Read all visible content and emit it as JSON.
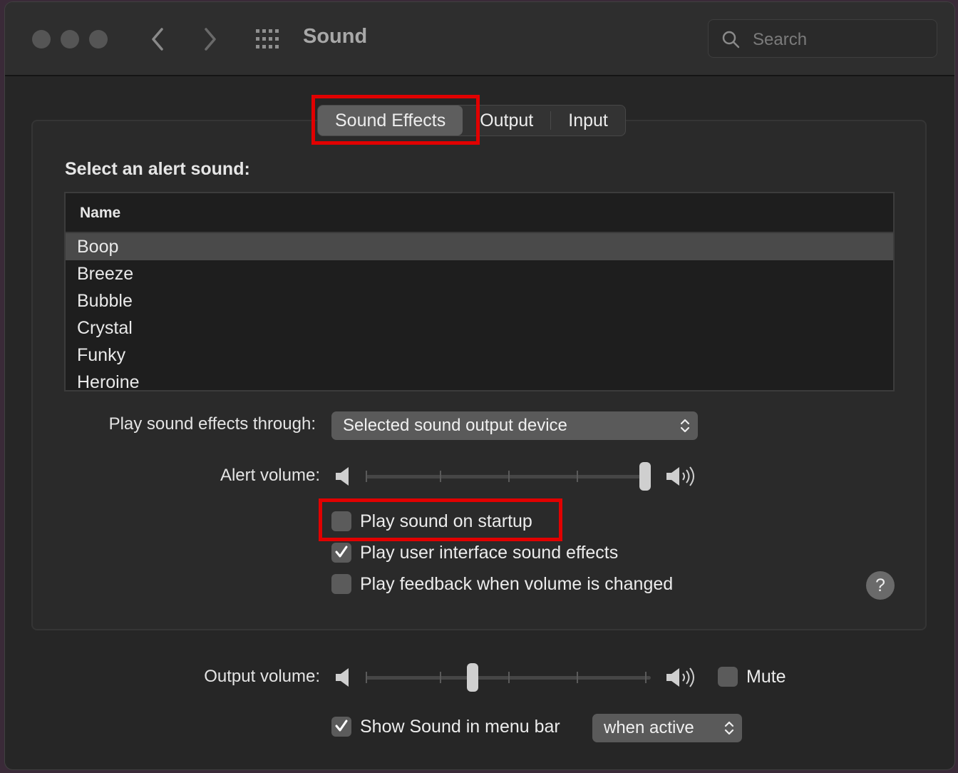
{
  "window": {
    "title": "Sound"
  },
  "search": {
    "placeholder": "Search"
  },
  "tabs": [
    {
      "label": "Sound Effects",
      "active": true
    },
    {
      "label": "Output",
      "active": false
    },
    {
      "label": "Input",
      "active": false
    }
  ],
  "alert": {
    "section_label": "Select an alert sound:",
    "column_header": "Name",
    "sounds": [
      "Boop",
      "Breeze",
      "Bubble",
      "Crystal",
      "Funky",
      "Heroine"
    ],
    "selected": "Boop"
  },
  "play_through": {
    "label": "Play sound effects through:",
    "value": "Selected sound output device"
  },
  "alert_volume": {
    "label": "Alert volume:",
    "level": 1.0
  },
  "checkboxes": {
    "startup": {
      "label": "Play sound on startup",
      "checked": false
    },
    "ui_effects": {
      "label": "Play user interface sound effects",
      "checked": true
    },
    "feedback": {
      "label": "Play feedback when volume is changed",
      "checked": false
    }
  },
  "help": {
    "label": "?"
  },
  "output_volume": {
    "label": "Output volume:",
    "level": 0.37
  },
  "mute": {
    "label": "Mute",
    "checked": false
  },
  "menu_bar": {
    "label": "Show Sound in menu bar",
    "checked": true,
    "option": "when active"
  },
  "colors": {
    "highlight": "#e10000",
    "window_bg": "#262626"
  },
  "icons": [
    "close-icon",
    "minimize-icon",
    "zoom-icon",
    "back-icon",
    "forward-icon",
    "grid-icon",
    "search-icon",
    "speaker-quiet-icon",
    "speaker-loud-icon",
    "checkmark-icon",
    "chevron-updown-icon",
    "help-icon"
  ]
}
